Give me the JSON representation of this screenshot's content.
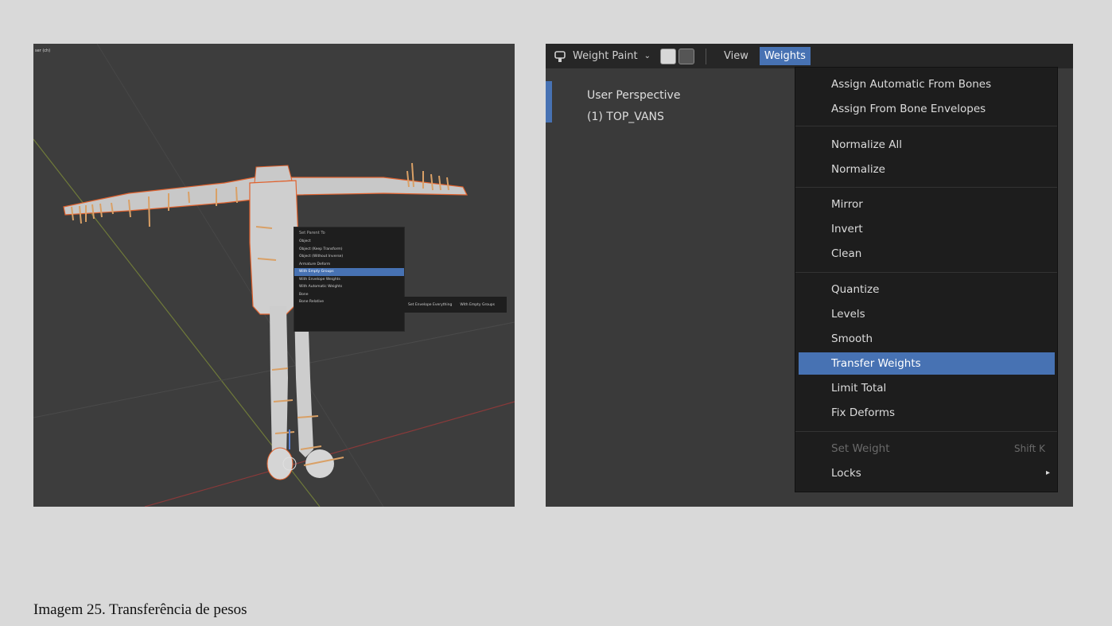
{
  "left_viewport": {
    "corner_label": "ser (ch)",
    "context_menu": {
      "title": "Set Parent To",
      "items": [
        {
          "label": "Object"
        },
        {
          "label": "Object (Keep Transform)"
        },
        {
          "label": "Object (Without Inverse)"
        },
        {
          "label": "Armature Deform"
        },
        {
          "label": "With Empty Groups",
          "highlighted": true
        },
        {
          "label": "With Envelope Weights"
        },
        {
          "label": "With Automatic Weights"
        },
        {
          "label": "Bone"
        },
        {
          "label": "Bone Relative"
        }
      ],
      "submenu": [
        "Set Envelope Everything",
        "With Empty Groups"
      ]
    }
  },
  "right_viewport": {
    "header": {
      "mode_icon": "weight-paint-icon",
      "mode_label": "Weight Paint",
      "mode_chevron": "⌄",
      "menus": [
        "View",
        "Weights"
      ],
      "active_menu": "Weights"
    },
    "viewport_info": {
      "perspective": "User Perspective",
      "object": "(1) TOP_VANS"
    },
    "weights_menu": {
      "items": [
        {
          "label": "Assign Automatic From Bones"
        },
        {
          "label": "Assign From Bone Envelopes"
        },
        {
          "label": "Normalize All"
        },
        {
          "label": "Normalize"
        },
        {
          "label": "Mirror"
        },
        {
          "label": "Invert"
        },
        {
          "label": "Clean"
        },
        {
          "label": "Quantize"
        },
        {
          "label": "Levels"
        },
        {
          "label": "Smooth"
        },
        {
          "label": "Transfer Weights",
          "highlighted": true
        },
        {
          "label": "Limit Total"
        },
        {
          "label": "Fix Deforms"
        },
        {
          "label": "Set Weight",
          "shortcut": "Shift K",
          "disabled": true
        },
        {
          "label": "Locks",
          "submenu_icon": "triangle-right-icon",
          "submenu_glyph": "▸"
        }
      ]
    }
  },
  "caption": "Imagem 25. Transferência de pesos",
  "colors": {
    "highlight": "#4772b3",
    "bone_orange": "#d9a066",
    "outline_orange": "#e0622e",
    "background": "#d9d9d9"
  }
}
